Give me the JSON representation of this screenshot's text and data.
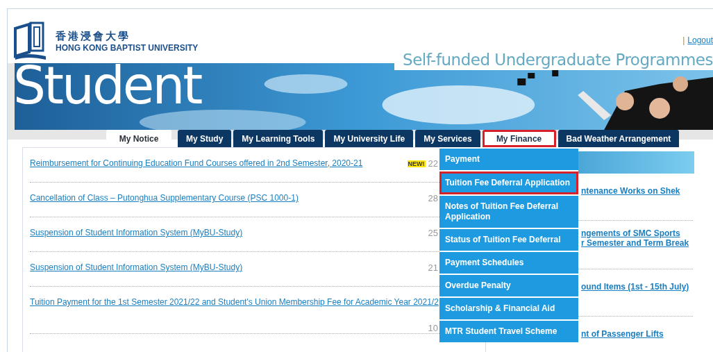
{
  "header": {
    "logo_chinese": "香港浸會大學",
    "logo_english": "HONG KONG BAPTIST UNIVERSITY",
    "logout_separator": "|",
    "logout": "Logout",
    "programme": "Self-funded Undergraduate Programmes"
  },
  "banner": {
    "title": "Student"
  },
  "tabs": [
    {
      "label": "My Notice",
      "selected": true,
      "open": false,
      "highlighted": false
    },
    {
      "label": "My Study",
      "selected": false,
      "open": false,
      "highlighted": false
    },
    {
      "label": "My Learning Tools",
      "selected": false,
      "open": false,
      "highlighted": false
    },
    {
      "label": "My University Life",
      "selected": false,
      "open": false,
      "highlighted": false
    },
    {
      "label": "My Services",
      "selected": false,
      "open": false,
      "highlighted": false
    },
    {
      "label": "My Finance",
      "selected": false,
      "open": true,
      "highlighted": true
    },
    {
      "label": "Bad Weather Arrangement",
      "selected": false,
      "open": false,
      "highlighted": false
    }
  ],
  "finance_menu": [
    {
      "label": "Payment",
      "highlighted": false
    },
    {
      "label": "Tuition Fee Deferral Application",
      "highlighted": true
    },
    {
      "label": "Notes of Tuition Fee Deferral Application",
      "highlighted": false
    },
    {
      "label": "Status of Tuition Fee Deferral",
      "highlighted": false
    },
    {
      "label": "Payment Schedules",
      "highlighted": false
    },
    {
      "label": "Overdue Penalty",
      "highlighted": false
    },
    {
      "label": "Scholarship & Financial Aid",
      "highlighted": false
    },
    {
      "label": "MTR Student Travel Scheme",
      "highlighted": false
    }
  ],
  "notices": [
    {
      "title": "Reimbursement for Continuing Education Fund Courses offered in 2nd Semester, 2020-21",
      "new": true,
      "date": "22"
    },
    {
      "title": "Cancellation of Class – Putonghua Supplementary Course (PSC 1000-1)",
      "new": false,
      "date": "28"
    },
    {
      "title": "Suspension of Student Information System (MyBU-Study)",
      "new": false,
      "date": "25"
    },
    {
      "title": "Suspension of Student Information System (MyBU-Study)",
      "new": false,
      "date": "21"
    },
    {
      "title": "Tuition Payment for the 1st Semester 2021/22 and Student's Union Membership Fee for Academic Year 2021/2",
      "new": false,
      "date": "10"
    }
  ],
  "new_badge": "NEW!",
  "campus_notices": [
    {
      "lines": [
        "ntenance Works on Shek"
      ]
    },
    {
      "lines": [
        "ngements of SMC Sports",
        "r Semester and Term Break"
      ]
    },
    {
      "lines": [
        "ound Items (1st - 15th July)"
      ]
    },
    {
      "lines": [
        "nt of Passenger Lifts"
      ]
    }
  ]
}
